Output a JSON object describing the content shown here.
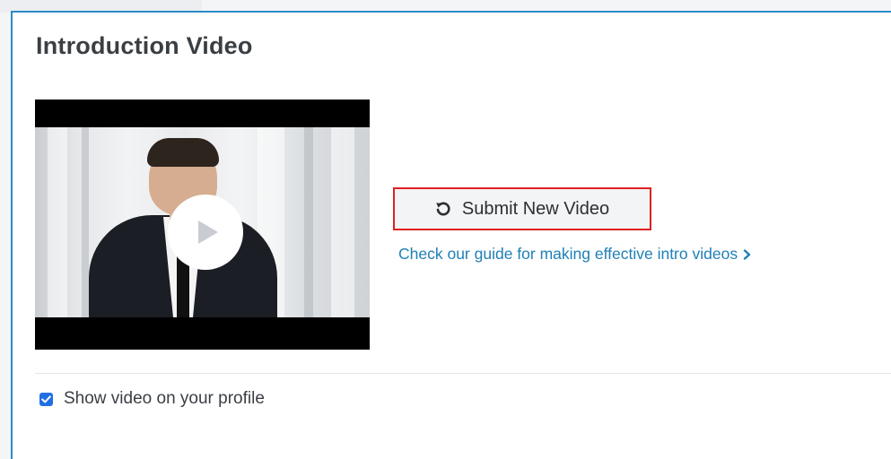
{
  "section": {
    "title": "Introduction Video"
  },
  "video": {
    "play_icon": "play-icon"
  },
  "actions": {
    "submit_label": "Submit New Video",
    "submit_icon": "redo-icon",
    "guide_link_text": "Check our guide for making effective intro videos",
    "guide_link_icon": "chevron-right-icon"
  },
  "profile_option": {
    "label": "Show video on your profile",
    "checked": true
  },
  "colors": {
    "card_border": "#2e8bc9",
    "highlight_border": "#e02020",
    "link": "#1f7fb6",
    "checkbox": "#1f6fe5"
  }
}
